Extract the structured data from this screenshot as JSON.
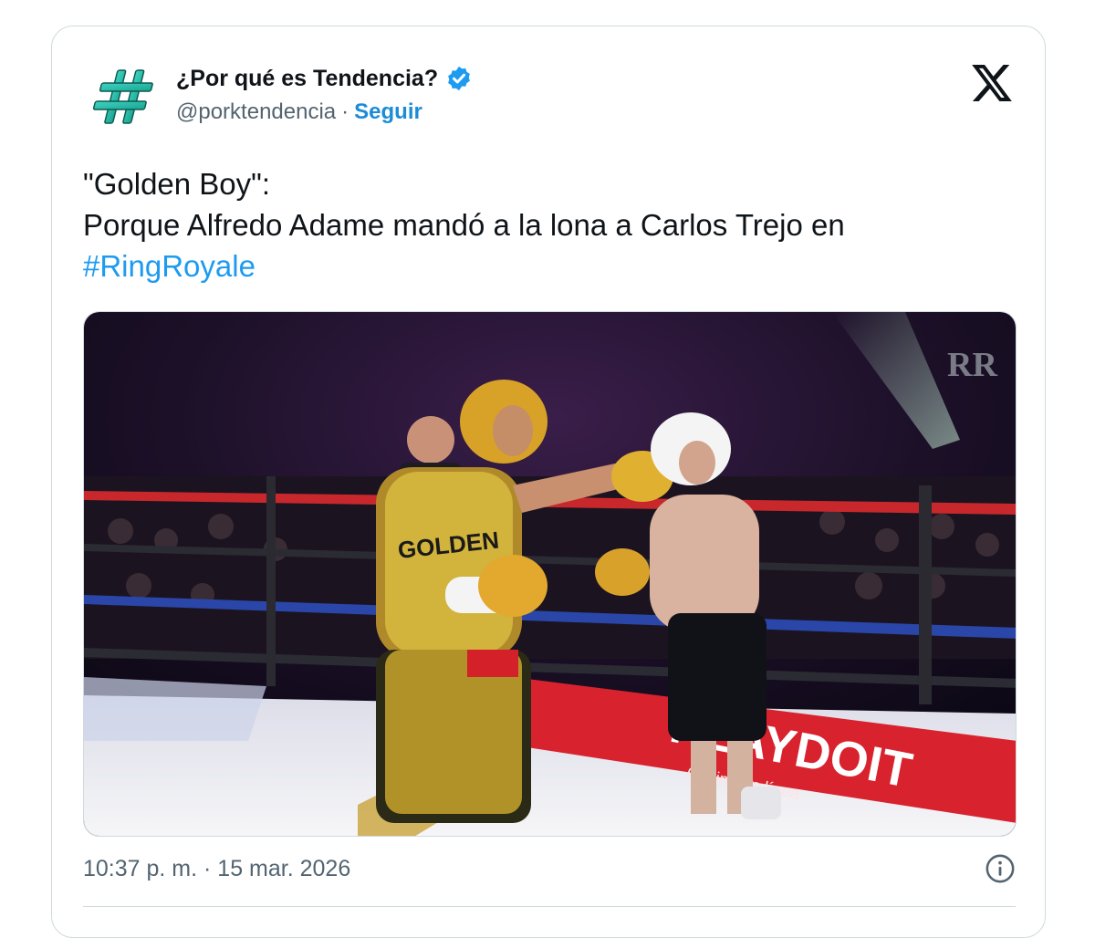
{
  "author": {
    "display_name": "¿Por qué es Tendencia?",
    "handle": "@porktendencia",
    "separator": "·",
    "follow_label": "Seguir",
    "avatar_symbol": "#"
  },
  "tweet": {
    "line1": "\"Golden Boy\":",
    "line2": "Porque Alfredo Adame mandó a la lona a Carlos Trejo en",
    "hashtag": "#RingRoyale"
  },
  "media": {
    "type": "video-frame",
    "description_icon": "boxing-match-image",
    "trunks_text": "GOLDEN",
    "sponsor_text": "PLAYDOIT",
    "sponsor_subtext": "Casino en línea",
    "logo_text": "RR"
  },
  "footer": {
    "timestamp": "10:37 p. m. · 15 mar. 2026"
  },
  "icons": {
    "verified": "verified-badge-icon",
    "x": "x-logo-icon",
    "info": "info-icon"
  },
  "colors": {
    "link": "#1d9bf0",
    "secondary_text": "#536471",
    "border": "#cfd9de"
  }
}
